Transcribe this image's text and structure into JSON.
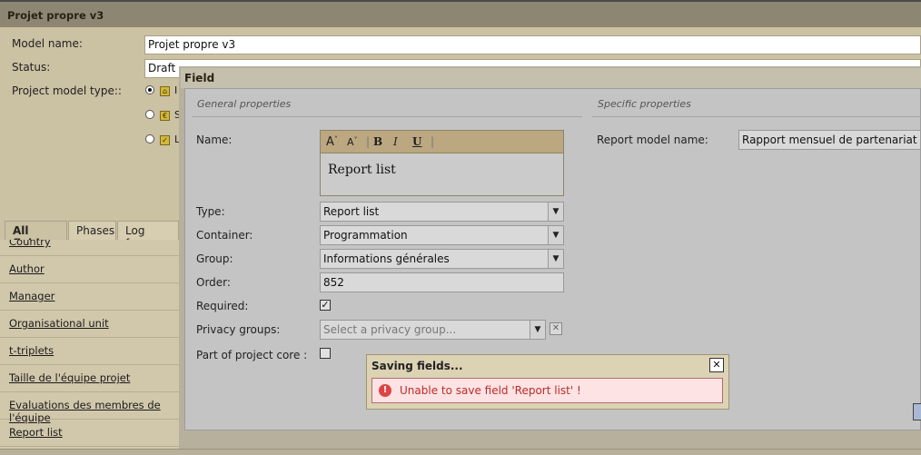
{
  "outer_window": {
    "title": "Projet propre v3",
    "model_name_label": "Model name:",
    "model_name_value": "Projet propre v3",
    "status_label": "Status:",
    "status_value": "Draft",
    "project_model_type_label": "Project model type::",
    "type_options": [
      {
        "letter": "I",
        "icon": "home-icon",
        "checked": true
      },
      {
        "letter": "S",
        "icon": "s-icon",
        "checked": false
      },
      {
        "letter": "L",
        "icon": "check-icon",
        "checked": false
      }
    ],
    "tabs": [
      "All fields",
      "Phases",
      "Log frame"
    ],
    "active_tab": "All fields",
    "fields_list": [
      "Country",
      "Author",
      "Manager",
      "Organisational unit",
      "t-triplets",
      "Taille de l'équipe projet",
      "Evaluations des membres de l'équipe",
      "Report list"
    ]
  },
  "field_dialog": {
    "title": "Field",
    "general_properties": "General properties",
    "specific_properties": "Specific properties",
    "name_label": "Name:",
    "name_value": "Report list",
    "toolbar_buttons": [
      "A",
      "A",
      "B",
      "I",
      "U"
    ],
    "type_label": "Type:",
    "type_value": "Report list",
    "container_label": "Container:",
    "container_value": "Programmation",
    "group_label": "Group:",
    "group_value": "Informations générales",
    "order_label": "Order:",
    "order_value": "852",
    "required_label": "Required:",
    "required_checked": true,
    "privacy_groups_label": "Privacy groups:",
    "privacy_groups_placeholder": "Select a privacy group...",
    "part_of_core_label": "Part of project core :",
    "part_of_core_checked": false,
    "report_model_name_label": "Report model name:",
    "report_model_name_value": "Rapport mensuel de partenariat loca"
  },
  "alert": {
    "title": "Saving fields...",
    "message": "Unable to save field 'Report list' !",
    "accent_color": "#c02a2a"
  }
}
